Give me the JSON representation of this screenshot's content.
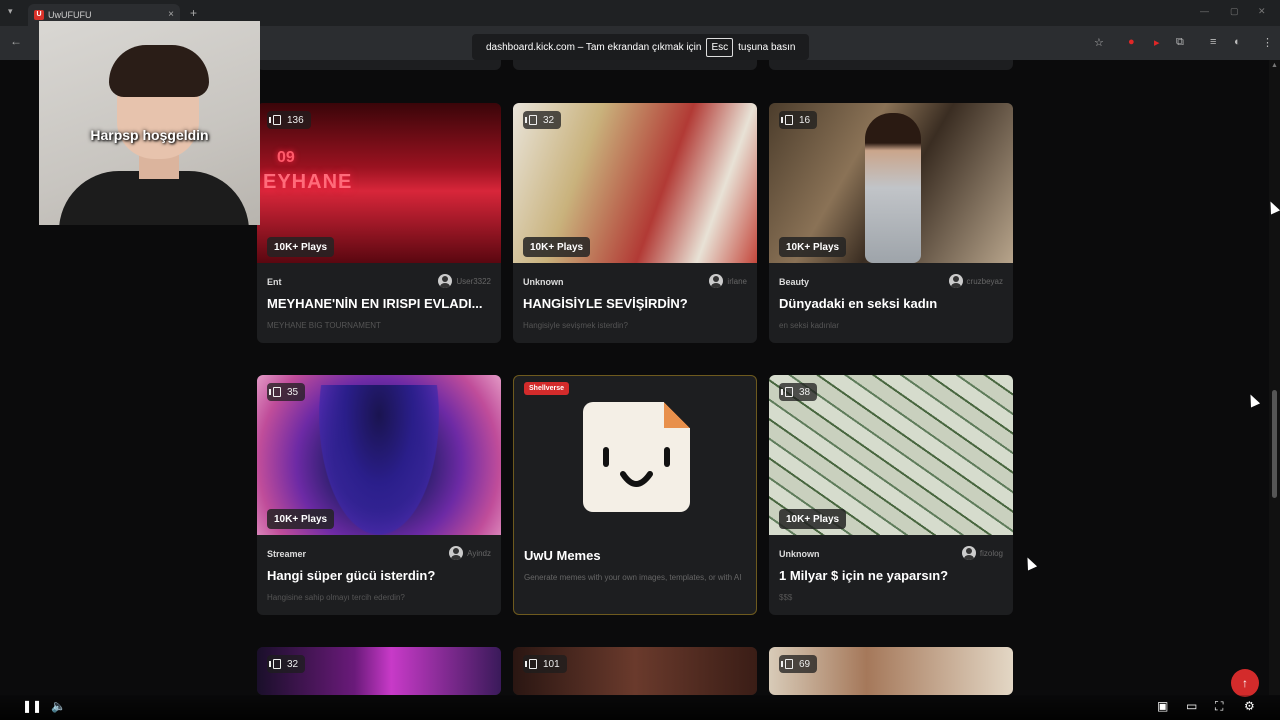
{
  "browser": {
    "tab_title": "UwUFUFU",
    "tab_favicon": "U",
    "fullscreen_notice_prefix": "dashboard.kick.com – Tam ekrandan çıkmak için",
    "fullscreen_notice_key": "Esc",
    "fullscreen_notice_suffix": "tuşuna basın"
  },
  "webcam": {
    "overlay_text": "Harpsp hoşgeldin"
  },
  "cards": [
    {
      "count": "136",
      "plays": "10K+ Plays",
      "category": "Ent",
      "author": "User3322",
      "title": "MEYHANE'NİN EN IRISPI EVLADI...",
      "desc": "MEYHANE BIG TOURNAMENT",
      "sign_top": "09",
      "sign_main": "EYHANE"
    },
    {
      "count": "32",
      "plays": "10K+ Plays",
      "category": "Unknown",
      "author": "irlane",
      "title": "HANGİSİYLE SEVİŞİRDİN?",
      "desc": "Hangisiyle sevişmek isterdin?"
    },
    {
      "count": "16",
      "plays": "10K+ Plays",
      "category": "Beauty",
      "author": "cruzbeyaz",
      "title": "Dünyadaki en seksi kadın",
      "desc": "en seksi kadınlar"
    },
    {
      "count": "35",
      "plays": "10K+ Plays",
      "category": "Streamer",
      "author": "Ayindz",
      "title": "Hangi süper gücü isterdin?",
      "desc": "Hangisine sahip olmayı tercih ederdin?"
    },
    {
      "badge": "Shellverse",
      "title": "UwU Memes",
      "desc": "Generate memes with your own images, templates, or with AI"
    },
    {
      "count": "38",
      "plays": "10K+ Plays",
      "category": "Unknown",
      "author": "fizolog",
      "title": "1 Milyar $ için ne yaparsın?",
      "desc": "$$$"
    }
  ],
  "bottom_counts": [
    "32",
    "101",
    "69"
  ],
  "player": {
    "pause_icon": "pause-icon",
    "volume_icon": "volume-icon"
  },
  "colors": {
    "accent_red": "#d32b2b",
    "card_bg": "#1d1e20",
    "page_bg": "#0b0b0c"
  }
}
